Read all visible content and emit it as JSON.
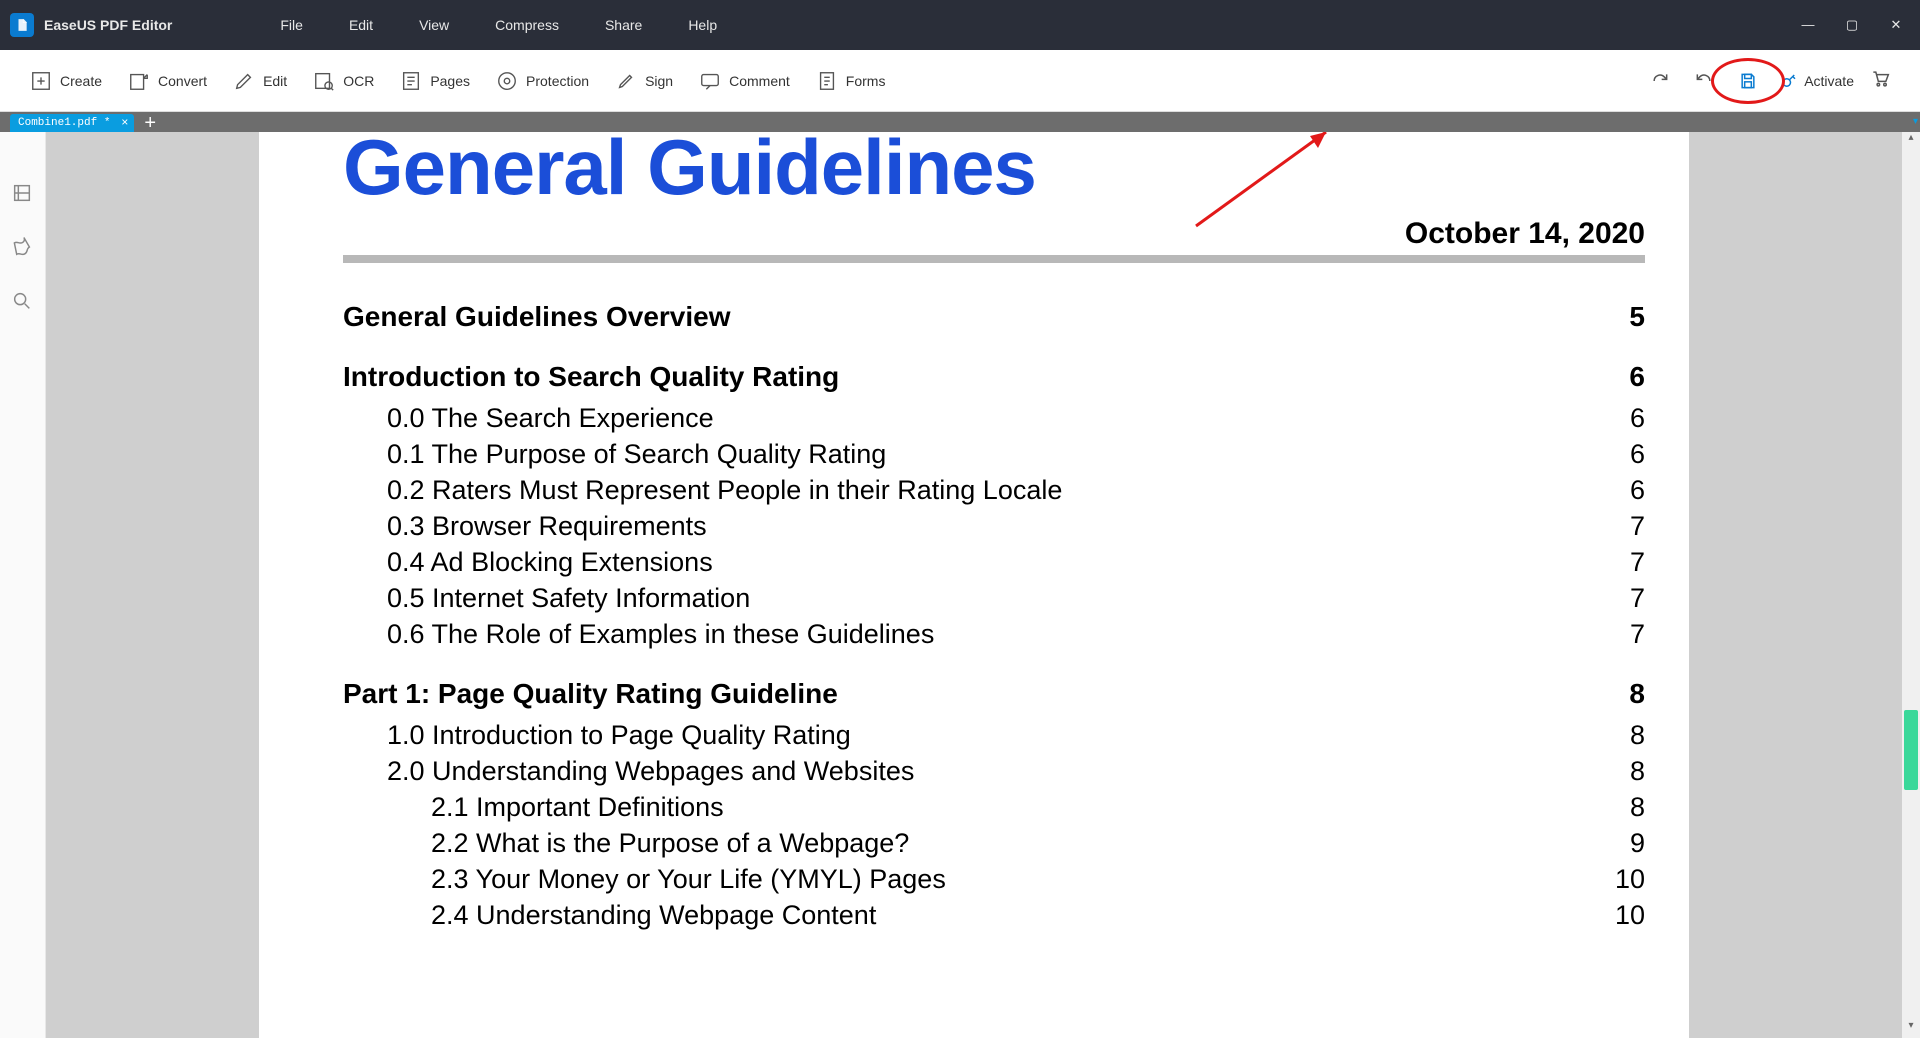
{
  "app": {
    "title": "EaseUS PDF Editor"
  },
  "menus": [
    "File",
    "Edit",
    "View",
    "Compress",
    "Share",
    "Help"
  ],
  "toolbar": {
    "create": "Create",
    "convert": "Convert",
    "edit": "Edit",
    "ocr": "OCR",
    "pages": "Pages",
    "protection": "Protection",
    "sign": "Sign",
    "comment": "Comment",
    "forms": "Forms",
    "activate": "Activate"
  },
  "tab": {
    "name": "Combine1.pdf *"
  },
  "document": {
    "title": "General Guidelines",
    "date": "October 14, 2020",
    "toc": [
      {
        "level": 0,
        "text": "General Guidelines Overview",
        "page": "5"
      },
      {
        "level": 0,
        "text": "Introduction to Search Quality Rating",
        "page": "6"
      },
      {
        "level": 1,
        "text": "0.0 The Search Experience",
        "page": "6"
      },
      {
        "level": 1,
        "text": "0.1 The Purpose of Search Quality Rating",
        "page": "6"
      },
      {
        "level": 1,
        "text": "0.2 Raters Must Represent People in their Rating Locale",
        "page": "6"
      },
      {
        "level": 1,
        "text": "0.3 Browser Requirements",
        "page": "7"
      },
      {
        "level": 1,
        "text": "0.4 Ad Blocking Extensions",
        "page": "7"
      },
      {
        "level": 1,
        "text": "0.5 Internet Safety Information",
        "page": "7"
      },
      {
        "level": 1,
        "text": "0.6 The Role of Examples in these Guidelines",
        "page": "7"
      },
      {
        "level": 0,
        "text": "Part 1: Page Quality Rating Guideline",
        "page": "8"
      },
      {
        "level": 1,
        "text": "1.0 Introduction to Page Quality Rating",
        "page": "8"
      },
      {
        "level": 1,
        "text": "2.0 Understanding Webpages and Websites",
        "page": "8"
      },
      {
        "level": 2,
        "text": "2.1 Important Definitions",
        "page": "8"
      },
      {
        "level": 2,
        "text": "2.2 What is the Purpose of a Webpage?",
        "page": "9"
      },
      {
        "level": 2,
        "text": "2.3 Your Money or Your Life (YMYL) Pages",
        "page": "10"
      },
      {
        "level": 2,
        "text": "2.4 Understanding Webpage Content",
        "page": "10"
      }
    ]
  }
}
